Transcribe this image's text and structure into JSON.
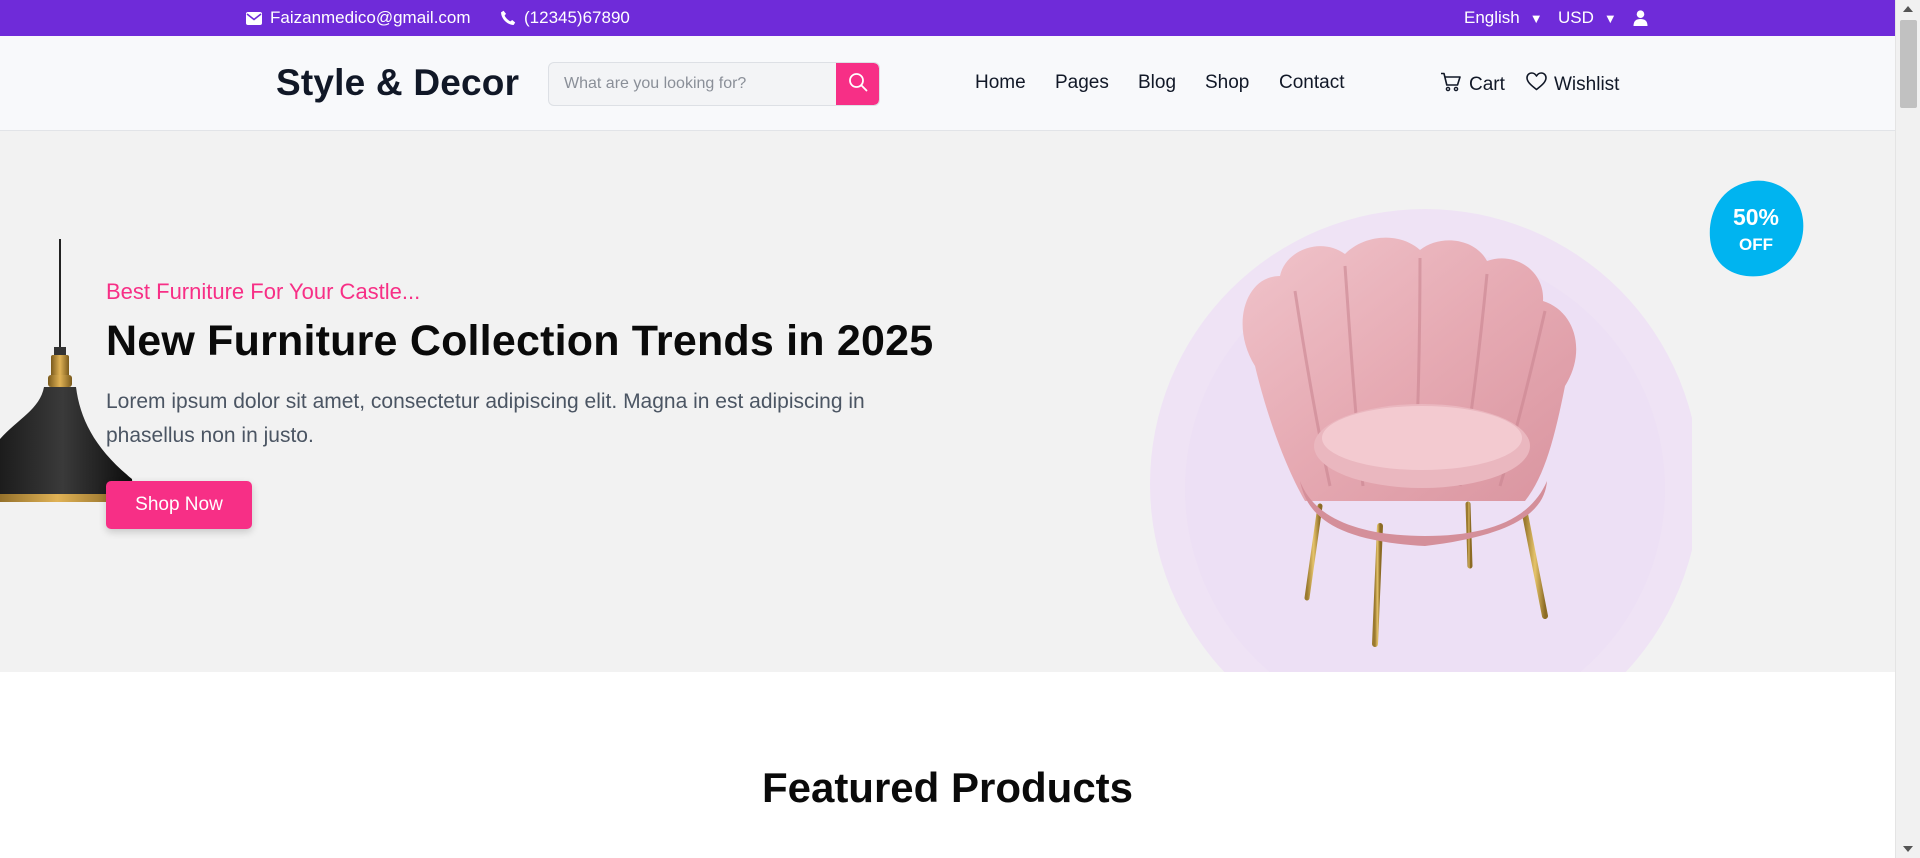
{
  "topbar": {
    "email": "Faizanmedico@gmail.com",
    "phone": "(12345)67890",
    "language": "English",
    "currency": "USD",
    "icons": [
      "envelope-icon",
      "phone-icon",
      "user-icon"
    ]
  },
  "header": {
    "brand": "Style & Decor",
    "search_placeholder": "What are you looking for?",
    "nav": [
      "Home",
      "Pages",
      "Blog",
      "Shop",
      "Contact"
    ],
    "cart_label": "Cart",
    "wishlist_label": "Wishlist"
  },
  "hero": {
    "tagline": "Best Furniture For Your Castle...",
    "title": "New Furniture Collection Trends in 2025",
    "description": "Lorem ipsum dolor sit amet, consectetur adipiscing elit. Magna in est adipiscing in phasellus non in justo.",
    "cta": "Shop Now",
    "badge_percent": "50%",
    "badge_text": "OFF"
  },
  "featured": {
    "title": "Featured Products"
  },
  "colors": {
    "topbar": "#6f2bd9",
    "accent": "#f72f86",
    "badge": "#00b4f0",
    "hero_bg": "#f2f2f2"
  }
}
